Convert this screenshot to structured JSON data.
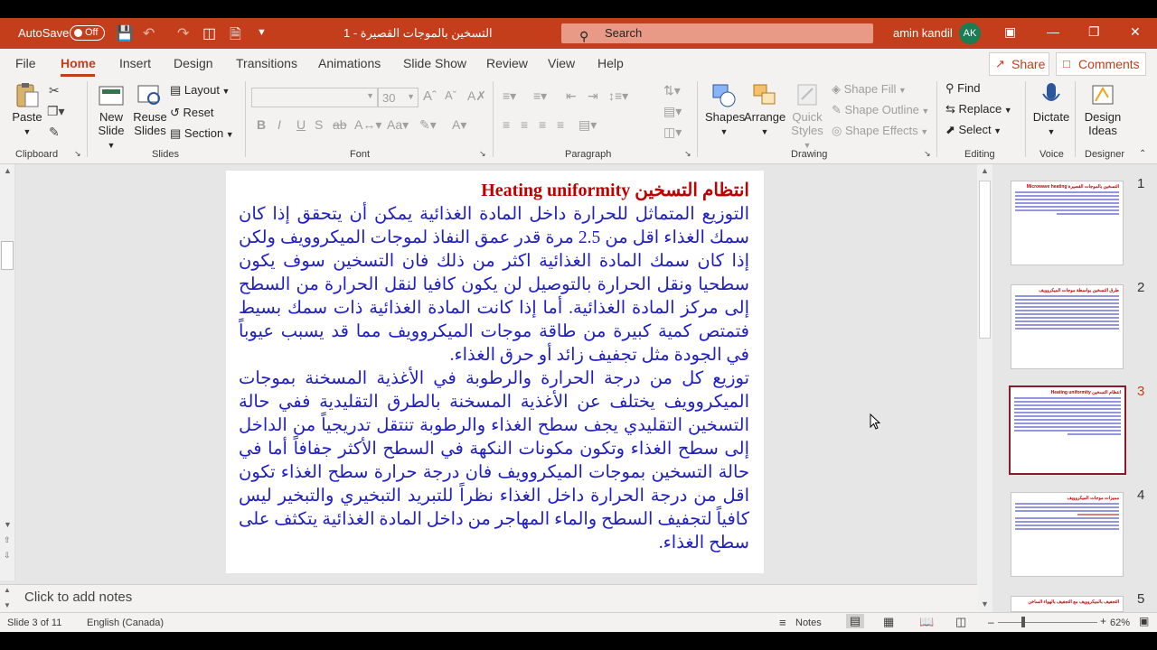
{
  "titlebar": {
    "autosave_label": "AutoSave",
    "autosave_state": "Off",
    "title": "التسخين بالموجات القصيرة - 1",
    "search_placeholder": "Search",
    "user_name": "amin kandil",
    "user_initials": "AK"
  },
  "menu": {
    "file": "File",
    "home": "Home",
    "insert": "Insert",
    "design": "Design",
    "transitions": "Transitions",
    "animations": "Animations",
    "slideshow": "Slide Show",
    "review": "Review",
    "view": "View",
    "help": "Help",
    "share": "Share",
    "comments": "Comments"
  },
  "ribbon": {
    "clipboard": {
      "paste": "Paste",
      "label": "Clipboard"
    },
    "slides": {
      "new_slide_1": "New",
      "new_slide_2": "Slide",
      "reuse_1": "Reuse",
      "reuse_2": "Slides",
      "layout": "Layout",
      "reset": "Reset",
      "section": "Section",
      "label": "Slides"
    },
    "font": {
      "size": "30",
      "label": "Font",
      "bold": "B",
      "italic": "I",
      "underline": "U",
      "strike": "S"
    },
    "paragraph": {
      "label": "Paragraph"
    },
    "drawing": {
      "shapes": "Shapes",
      "arrange": "Arrange",
      "quick_1": "Quick",
      "quick_2": "Styles",
      "fill": "Shape Fill",
      "outline": "Shape Outline",
      "effects": "Shape Effects",
      "label": "Drawing"
    },
    "editing": {
      "find": "Find",
      "replace": "Replace",
      "select": "Select",
      "label": "Editing"
    },
    "voice": {
      "dictate": "Dictate",
      "label": "Voice"
    },
    "designer": {
      "ideas_1": "Design",
      "ideas_2": "Ideas",
      "label": "Designer"
    }
  },
  "slide": {
    "title": "انتظام التسخين Heating uniformity",
    "body": "التوزيع المتماثل للحرارة داخل المادة الغذائية يمكن أن يتحقق إذا كان سمك الغذاء اقل من 2.5 مرة قدر عمق النفاذ لموجات الميكروويف ولكن إذا كان سمك المادة الغذائية اكثر من ذلك فان التسخين سوف يكون سطحيا ونقل الحرارة بالتوصيل لن يكون كافيا لنقل الحرارة من السطح إلى مركز المادة الغذائية. أما إذا كانت المادة الغذائية ذات سمك بسيط فتمتص كمية كبيرة من طاقة موجات الميكروويف مما قد يسبب عيوباً في الجودة مثل تجفيف زائد أو حرق الغذاء.\nتوزيع كل من درجة الحرارة والرطوبة في الأغذية المسخنة بموجات الميكروويف يختلف عن الأغذية المسخنة بالطرق التقليدية ففي حالة التسخين التقليدي يجف سطح الغذاء والرطوبة تنتقل تدريجياً من الداخل إلى سطح الغذاء وتكون مكونات النكهة في السطح الأكثر جفافاً أما في حالة التسخين بموجات الميكروويف فان درجة حرارة سطح الغذاء تكون اقل من درجة الحرارة داخل الغذاء نظراً للتبريد التبخيري والتبخير ليس كافياً لتجفيف السطح والماء المهاجر من داخل المادة الغذائية يتكثف على سطح الغذاء."
  },
  "thumbnails": [
    {
      "num": "1",
      "title": "التسخين بالموجات القصيرة Microwave heating"
    },
    {
      "num": "2",
      "title": "طرق التسخين بواسطة موجات الميكروويف"
    },
    {
      "num": "3",
      "title": "انتظام التسخين Heating uniformity"
    },
    {
      "num": "4",
      "title": "مميزات موجات الميكروويف"
    },
    {
      "num": "5",
      "title": "التجفيف بالميكروويف مع التجفيف بالهواء الساخن"
    }
  ],
  "notes_placeholder": "Click to add notes",
  "status": {
    "slide_info": "Slide 3 of 11",
    "language": "English (Canada)",
    "notes": "Notes",
    "zoom": "62%"
  }
}
